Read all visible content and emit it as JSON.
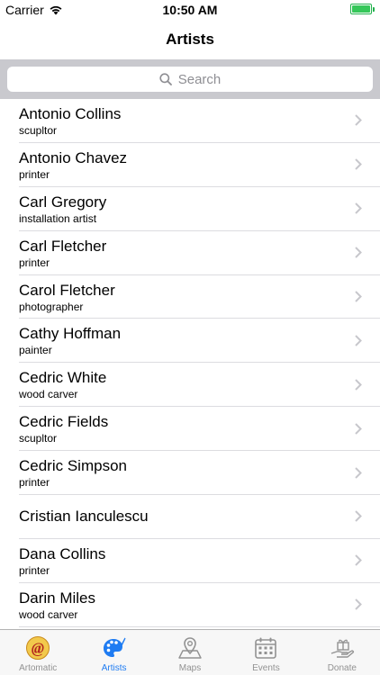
{
  "status_bar": {
    "carrier": "Carrier",
    "time": "10:50 AM"
  },
  "nav": {
    "title": "Artists"
  },
  "search": {
    "placeholder": "Search"
  },
  "artists": [
    {
      "name": "Antonio Collins",
      "role": "scupltor"
    },
    {
      "name": "Antonio Chavez",
      "role": "printer"
    },
    {
      "name": "Carl Gregory",
      "role": "installation artist"
    },
    {
      "name": "Carl Fletcher",
      "role": "printer"
    },
    {
      "name": "Carol Fletcher",
      "role": "photographer"
    },
    {
      "name": "Cathy Hoffman",
      "role": "painter"
    },
    {
      "name": "Cedric White",
      "role": "wood carver"
    },
    {
      "name": "Cedric Fields",
      "role": "scupltor"
    },
    {
      "name": "Cedric Simpson",
      "role": "printer"
    },
    {
      "name": "Cristian Ianculescu",
      "role": ""
    },
    {
      "name": "Dana Collins",
      "role": "printer"
    },
    {
      "name": "Darin Miles",
      "role": "wood carver"
    }
  ],
  "tabs": [
    {
      "label": "Artomatic",
      "icon": "artomatic-logo-icon",
      "active": false
    },
    {
      "label": "Artists",
      "icon": "palette-icon",
      "active": true
    },
    {
      "label": "Maps",
      "icon": "map-pin-icon",
      "active": false
    },
    {
      "label": "Events",
      "icon": "calendar-icon",
      "active": false
    },
    {
      "label": "Donate",
      "icon": "gift-hand-icon",
      "active": false
    }
  ],
  "colors": {
    "accent": "#1f7cf2",
    "inactive": "#929292",
    "battery": "#35c759"
  }
}
